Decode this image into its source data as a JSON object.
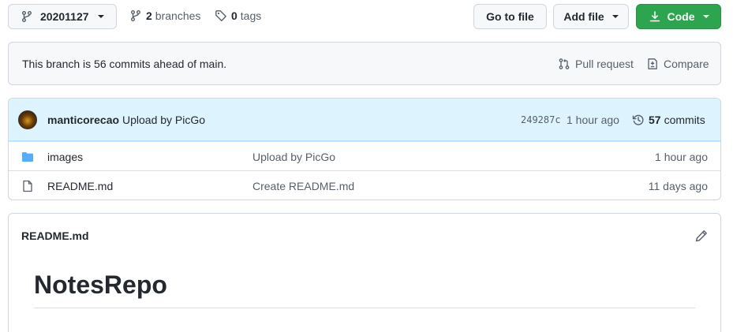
{
  "toolbar": {
    "branch_label": "20201127",
    "branches_count": "2",
    "branches_label": "branches",
    "tags_count": "0",
    "tags_label": "tags",
    "goto_label": "Go to file",
    "addfile_label": "Add file",
    "code_label": "Code"
  },
  "ahead": {
    "text": "This branch is 56 commits ahead of main.",
    "pull_request_label": "Pull request",
    "compare_label": "Compare"
  },
  "latest_commit": {
    "author": "manticorecao",
    "message": "Upload by PicGo",
    "sha": "249287c",
    "time": "1 hour ago",
    "commits_count": "57",
    "commits_label": "commits"
  },
  "files": [
    {
      "name": "images",
      "type": "folder",
      "message": "Upload by PicGo",
      "age": "1 hour ago"
    },
    {
      "name": "README.md",
      "type": "file",
      "message": "Create README.md",
      "age": "11 days ago"
    }
  ],
  "readme": {
    "file_label": "README.md",
    "heading": "NotesRepo"
  },
  "colors": {
    "code_button": "#2da44e",
    "commit_bar": "#ddf4ff",
    "folder_icon": "#54aeff"
  }
}
